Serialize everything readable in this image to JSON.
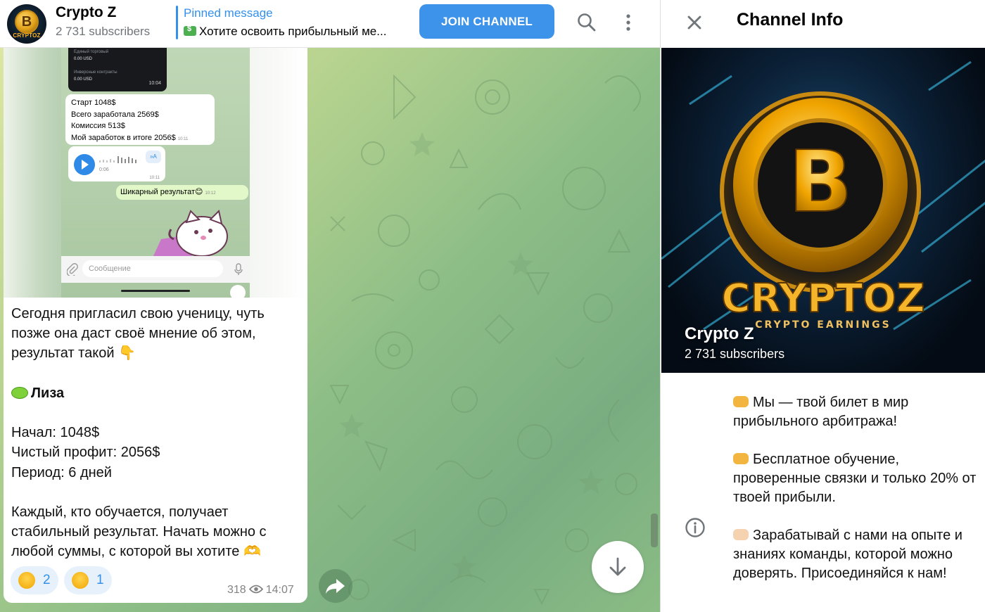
{
  "header": {
    "channel_name": "Crypto Z",
    "subscribers": "2 731 subscribers",
    "avatar_text": "CRYPTOZ",
    "pinned_title": "Pinned message",
    "pinned_text": "Хотите освоить прибыльный ме...",
    "join_label": "JOIN CHANNEL"
  },
  "screenshot": {
    "dark_rows": [
      {
        "label": "Единый торговый",
        "value": "0.00 USD"
      },
      {
        "label": "Инверсные контракты",
        "value": "0.00 USD"
      }
    ],
    "dark_time": "10:04",
    "stats_lines": [
      "Старт 1048$",
      "Всего заработала 2569$",
      "Комиссия 513$",
      "Мой заработок в итоге 2056$"
    ],
    "stats_time": "10:11",
    "voice_duration": "0:06",
    "voice_time": "10:11",
    "voice_transcribe": "»A",
    "reply_text": "Шикарный результат😊",
    "reply_time": "10:12",
    "input_placeholder": "Сообщение"
  },
  "message": {
    "intro": "Сегодня пригласил свою ученицу, чуть позже она даст своё мнение об этом, результат такой 👇",
    "student_name": "Лиза",
    "started": "Начал: 1048$",
    "profit": "Чистый профит: 2056$",
    "period": "Период: 6 дней",
    "outro": "Каждый, кто обучается, получает стабильный результат. Начать можно с любой суммы, с которой вы хотите 🫶",
    "reactions": [
      {
        "emoji": "🥴",
        "count": "2"
      },
      {
        "emoji": "😭",
        "count": "1"
      }
    ],
    "views": "318",
    "time": "14:07"
  },
  "info": {
    "title": "Channel Info",
    "cover_name": "Crypto Z",
    "cover_subs": "2 731 subscribers",
    "cover_logo": "CRYPTOZ",
    "cover_tagline": "CRYPTO EARNINGS",
    "about_1": "Мы — твой билет в мир прибыльного арбитража!",
    "about_2": "Бесплатное обучение, проверенные связки и только 20% от твоей прибыли.",
    "about_3": "Зарабатывай с нами на опыте и знаниях команды, которой можно доверять. Присоединяйся к нам!"
  },
  "colors": {
    "accent": "#3390ec",
    "join_button": "#3d93e9",
    "reaction_bg": "#e6f1fc",
    "coin_gold": "#f0a400"
  },
  "icons": [
    "search-icon",
    "more-vertical-icon",
    "close-icon",
    "info-icon",
    "share-icon",
    "arrow-down-icon",
    "eye-icon",
    "play-icon",
    "paperclip-icon",
    "microphone-icon"
  ]
}
